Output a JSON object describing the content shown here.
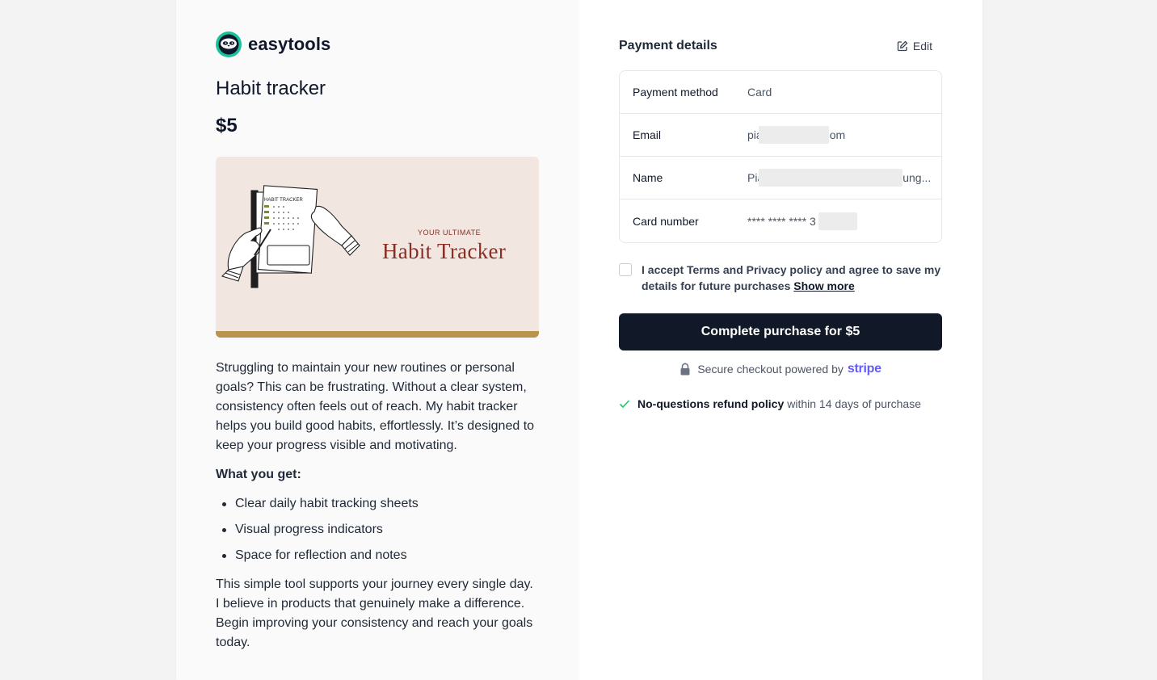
{
  "brand": {
    "name": "easytools",
    "logo": "sloth-logo-icon"
  },
  "product": {
    "title": "Habit tracker",
    "price": "$5",
    "image": {
      "subtitle": "YOUR ULTIMATE",
      "title": "Habit Tracker",
      "sheet_label": "HABIT TRACKER"
    },
    "description": {
      "paragraph1": "Struggling to maintain your new routines or personal goals? This can be frustrating. Without a clear system, consistency often feels out of reach. My habit tracker helps you build good habits, effortlessly. It’s designed to keep your progress visible and motivating.",
      "heading": "What you get:",
      "items": [
        "Clear daily habit tracking sheets",
        "Visual progress indicators",
        "Space for reflection and notes"
      ],
      "paragraph2": "This simple tool supports your journey every single day. I believe in products that genuinely make a difference. Begin improving your consistency and reach your goals today."
    }
  },
  "payment": {
    "title": "Payment details",
    "edit_label": "Edit",
    "rows": [
      {
        "label": "Payment method",
        "value": "Card"
      },
      {
        "label": "Email",
        "value_start": "pia",
        "value_end": "om"
      },
      {
        "label": "Name",
        "value_start": "Pia",
        "value_end": "ung..."
      },
      {
        "label": "Card number",
        "value": "**** **** **** 3"
      }
    ]
  },
  "consent": {
    "text": "I accept Terms and Privacy policy and agree to save my details for future purchases",
    "link": "Show more"
  },
  "checkout": {
    "button_label": "Complete purchase for $5",
    "secure_text": "Secure checkout powered by",
    "provider": "stripe",
    "refund_bold": "No-questions refund policy",
    "refund_rest": "within 14 days of purchase"
  },
  "colors": {
    "button": "#111827",
    "stripe": "#635bff",
    "accent_green": "#22c55e"
  }
}
